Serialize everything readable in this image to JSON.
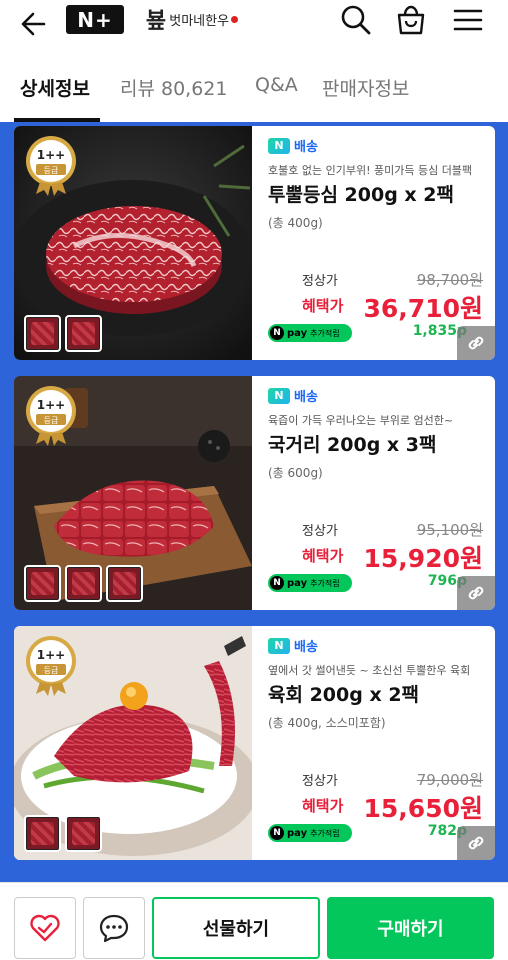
{
  "header": {
    "back_icon": "back-arrow-icon",
    "logo_text": "N+",
    "brand_mark": "뵾",
    "brand_name": "벗마네한우",
    "icons": [
      "search-icon",
      "shopping-bag-icon",
      "menu-icon"
    ]
  },
  "tabs": [
    {
      "label": "상세정보",
      "active": true
    },
    {
      "label": "리뷰 80,621",
      "active": false
    },
    {
      "label": "Q&A",
      "active": false
    },
    {
      "label": "판매자정보",
      "active": false
    }
  ],
  "products": [
    {
      "grade_top": "1++",
      "grade_bottom": "등급",
      "shipping": "배송",
      "description": "호불호 없는 인기부위! 풍미가득 등심 더블팩",
      "name": "투뿔등심 200g x 2팩",
      "amount": "(총 400g)",
      "regular_label": "정상가",
      "regular_price": "98,700원",
      "benefit_label": "혜택가",
      "benefit_price": "36,710원",
      "npay_label": "pay",
      "npay_sub": "추가적립",
      "points": "1,835p",
      "thumb_count": 2
    },
    {
      "grade_top": "1++",
      "grade_bottom": "등급",
      "shipping": "배송",
      "description": "육즙이 가득 우러나오는 부위로 엄선한~",
      "name": "국거리 200g x 3팩",
      "amount": "(총 600g)",
      "regular_label": "정상가",
      "regular_price": "95,100원",
      "benefit_label": "혜택가",
      "benefit_price": "15,920원",
      "npay_label": "pay",
      "npay_sub": "추가적립",
      "points": "796p",
      "thumb_count": 3
    },
    {
      "grade_top": "1++",
      "grade_bottom": "등급",
      "shipping": "배송",
      "description": "옆에서 갓 썰어낸듯 ~ 초신선 투뿔한우 육회",
      "name": "육회 200g x 2팩",
      "amount": "(총 400g, 소스미포함)",
      "regular_label": "정상가",
      "regular_price": "79,000원",
      "benefit_label": "혜택가",
      "benefit_price": "15,650원",
      "npay_label": "pay",
      "npay_sub": "추가적립",
      "points": "782p",
      "thumb_count": 2
    }
  ],
  "bottom": {
    "wish_icon": "heart-check-icon",
    "chat_icon": "chat-bubble-icon",
    "gift_label": "선물하기",
    "buy_label": "구매하기"
  },
  "colors": {
    "accent_green": "#03c75a",
    "price_red": "#e8203a",
    "ship_blue": "#1c68f3",
    "banner_blue": "#2e64da"
  }
}
